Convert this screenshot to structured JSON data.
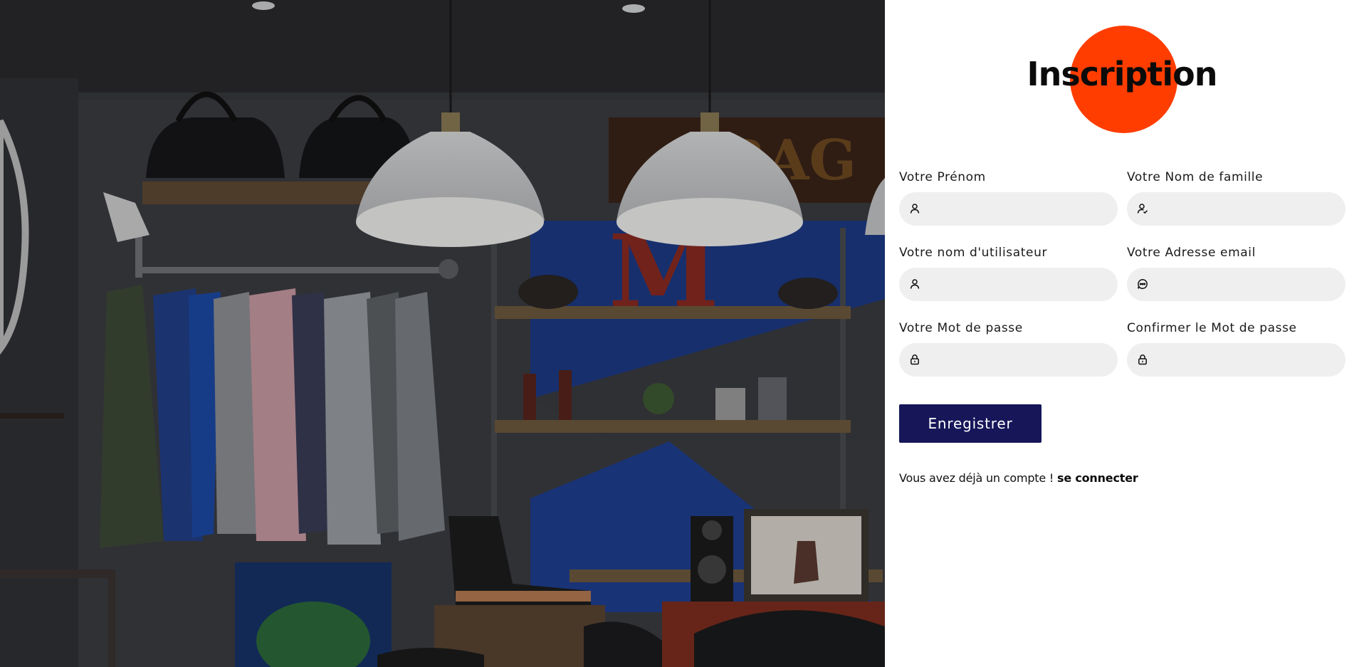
{
  "page": {
    "title": "Inscription"
  },
  "form": {
    "fields": [
      {
        "label": "Votre Prénom",
        "value": "",
        "placeholder": "",
        "icon": "user-icon"
      },
      {
        "label": "Votre Nom de famille",
        "value": "",
        "placeholder": "",
        "icon": "user-check-icon"
      },
      {
        "label": "Votre nom d'utilisateur",
        "value": "",
        "placeholder": "",
        "icon": "user-icon"
      },
      {
        "label": "Votre Adresse email",
        "value": "",
        "placeholder": "",
        "icon": "chat-bubble-icon"
      },
      {
        "label": "Votre Mot de passe",
        "value": "",
        "placeholder": "",
        "icon": "lock-icon"
      },
      {
        "label": "Confirmer le Mot de passe",
        "value": "",
        "placeholder": "",
        "icon": "lock-icon"
      }
    ],
    "submit_label": "Enregistrer"
  },
  "footer": {
    "prompt": "Vous avez déjà un compte !",
    "link_label": "se connecter"
  },
  "colors": {
    "accent_circle": "#ff3d00",
    "submit_button": "#161659",
    "input_background": "#efefef"
  }
}
